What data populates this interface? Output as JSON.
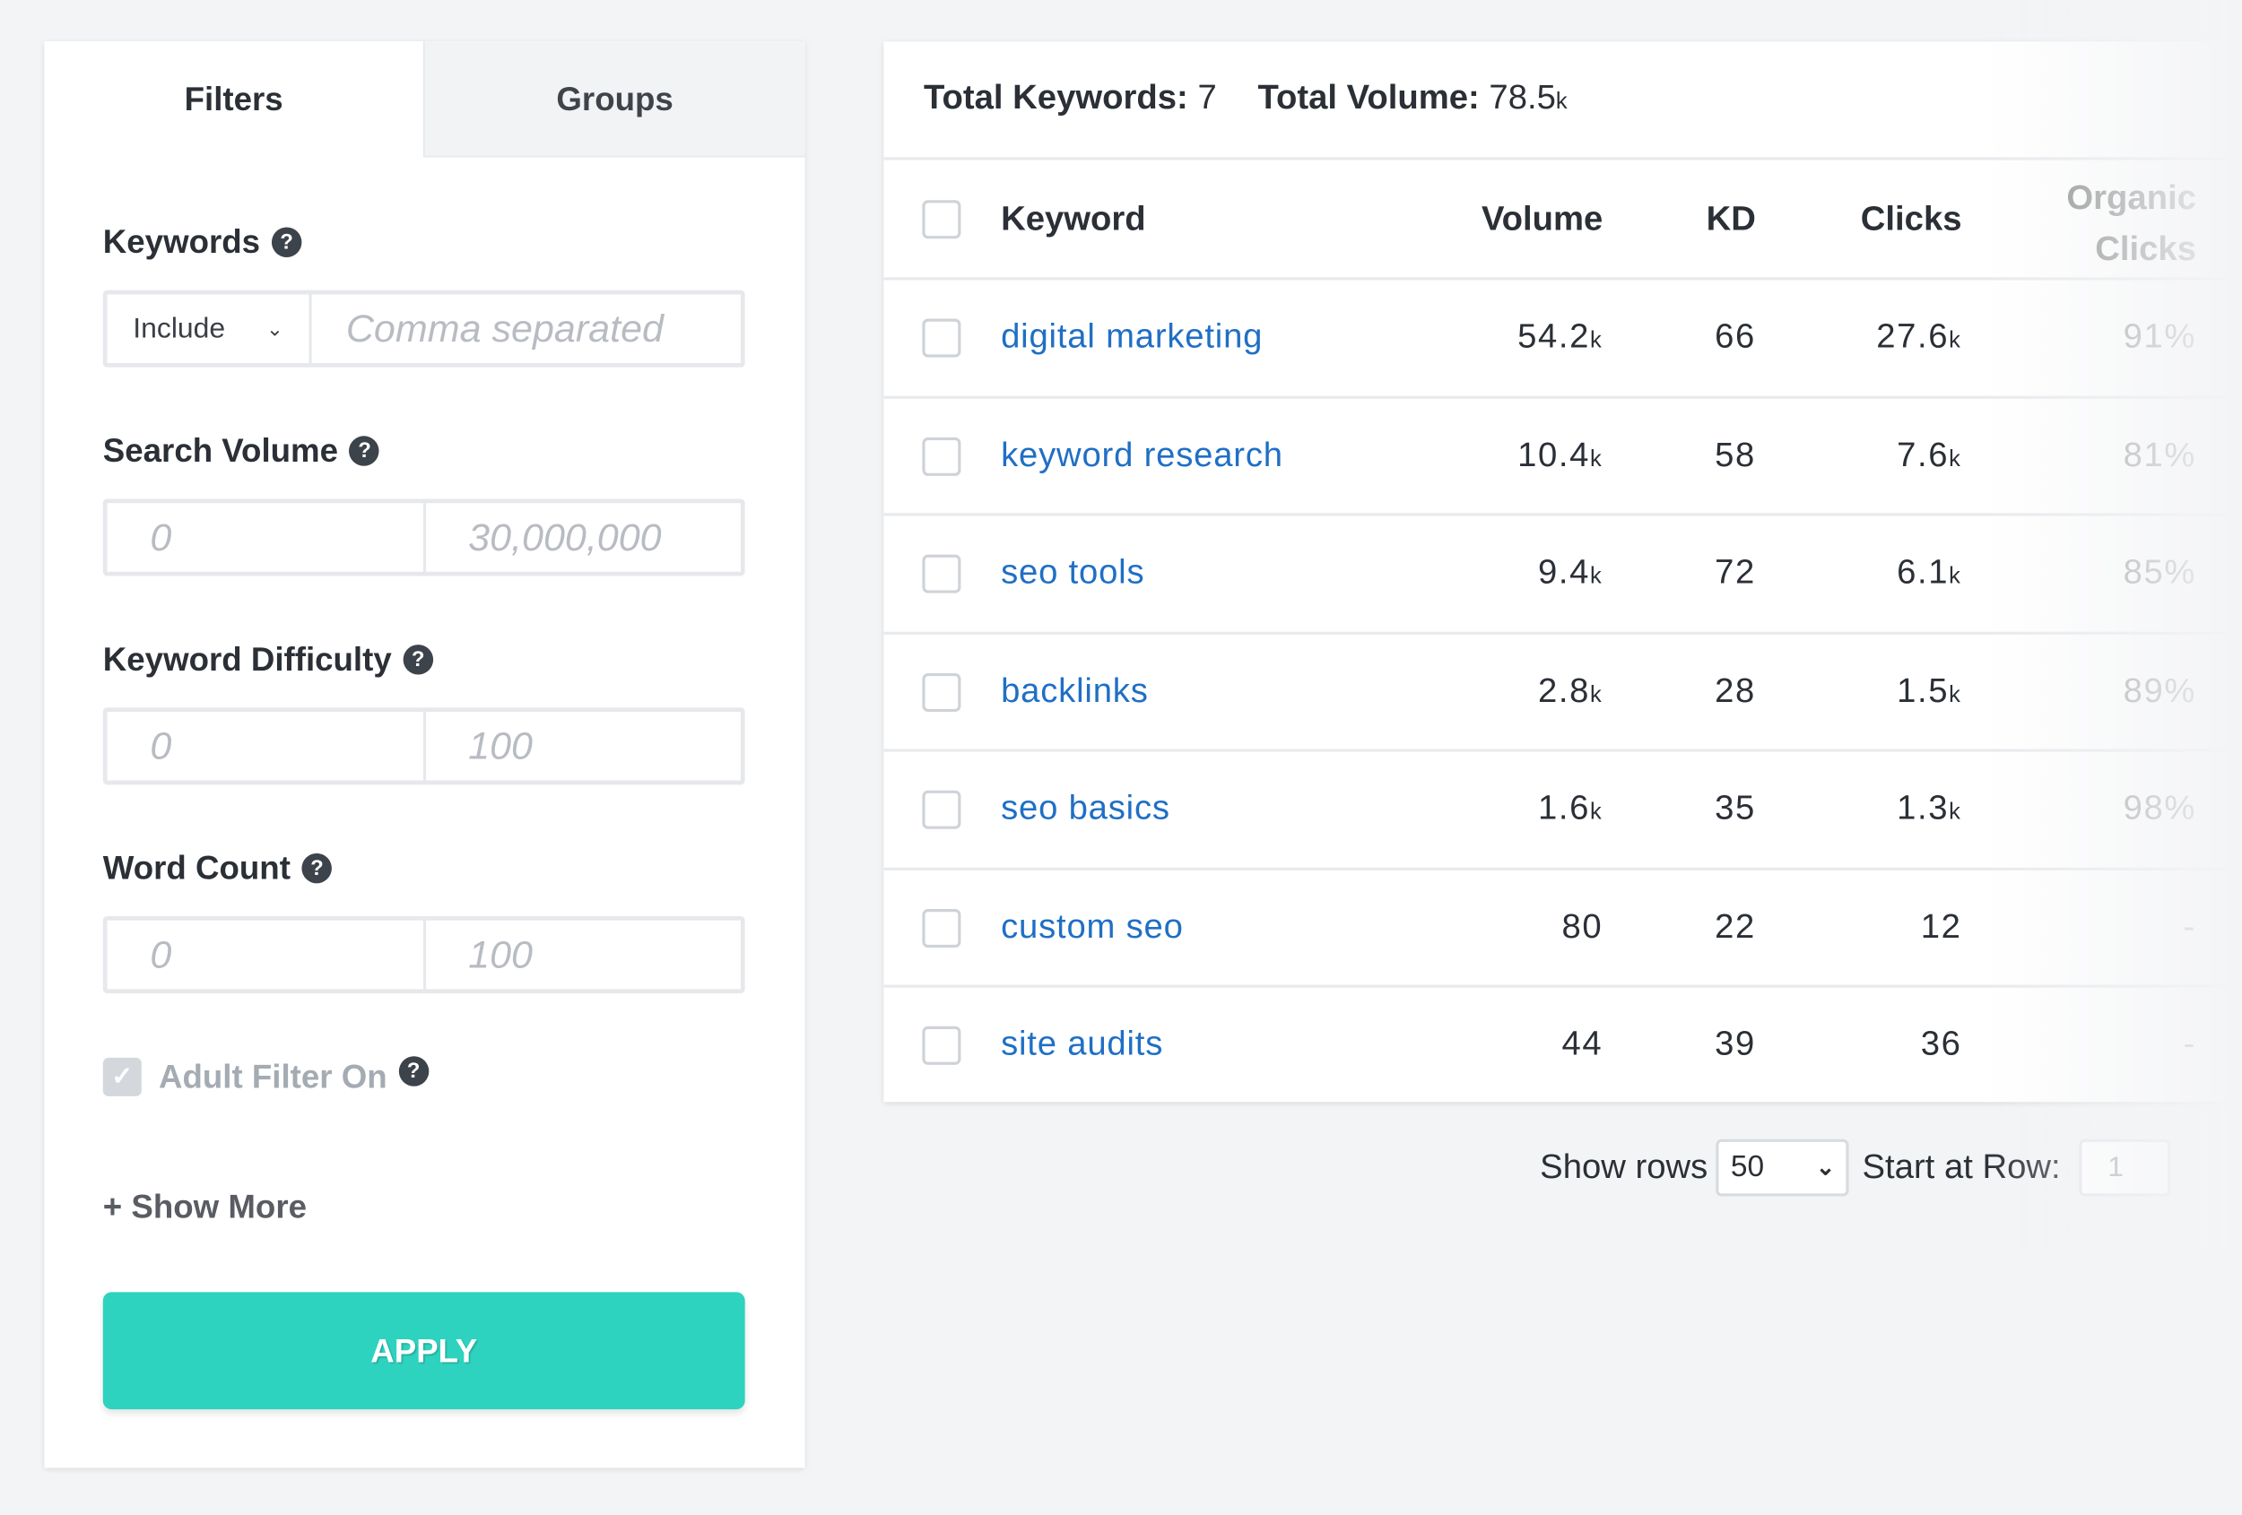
{
  "tabs": {
    "filters": "Filters",
    "groups": "Groups"
  },
  "filters": {
    "keywords": {
      "label": "Keywords",
      "mode": "Include",
      "placeholder": "Comma separated"
    },
    "search_volume": {
      "label": "Search Volume",
      "min": "0",
      "max": "30,000,000"
    },
    "keyword_difficulty": {
      "label": "Keyword Difficulty",
      "min": "0",
      "max": "100"
    },
    "word_count": {
      "label": "Word Count",
      "min": "0",
      "max": "100"
    },
    "adult_filter": {
      "label": "Adult Filter On",
      "checked": true
    },
    "show_more": "+ Show More",
    "apply": "APPLY",
    "help_glyph": "?"
  },
  "summary": {
    "total_keywords_label": "Total Keywords:",
    "total_keywords": "7",
    "total_volume_label": "Total Volume:",
    "total_volume": "78.5",
    "total_volume_unit": "k"
  },
  "table": {
    "headers": [
      "Keyword",
      "Volume",
      "KD",
      "Clicks",
      "Organic",
      "Clicks"
    ],
    "rows": [
      {
        "keyword": "digital marketing",
        "volume": "54.2",
        "vu": "k",
        "kd": "66",
        "clicks": "27.6",
        "cu": "k",
        "organic": "91%"
      },
      {
        "keyword": "keyword research",
        "volume": "10.4",
        "vu": "k",
        "kd": "58",
        "clicks": "7.6",
        "cu": "k",
        "organic": "81%"
      },
      {
        "keyword": "seo tools",
        "volume": "9.4",
        "vu": "k",
        "kd": "72",
        "clicks": "6.1",
        "cu": "k",
        "organic": "85%"
      },
      {
        "keyword": "backlinks",
        "volume": "2.8",
        "vu": "k",
        "kd": "28",
        "clicks": "1.5",
        "cu": "k",
        "organic": "89%"
      },
      {
        "keyword": "seo basics",
        "volume": "1.6",
        "vu": "k",
        "kd": "35",
        "clicks": "1.3",
        "cu": "k",
        "organic": "98%"
      },
      {
        "keyword": "custom seo",
        "volume": "80",
        "vu": "",
        "kd": "22",
        "clicks": "12",
        "cu": "",
        "organic": "-"
      },
      {
        "keyword": "site audits",
        "volume": "44",
        "vu": "",
        "kd": "39",
        "clicks": "36",
        "cu": "",
        "organic": "-"
      }
    ]
  },
  "footer": {
    "show_rows_label": "Show rows",
    "show_rows_value": "50",
    "start_row_label": "Start at Row:",
    "start_row_value": "1"
  },
  "colors": {
    "accent": "#2ed3bf",
    "link": "#1f6fc5"
  }
}
